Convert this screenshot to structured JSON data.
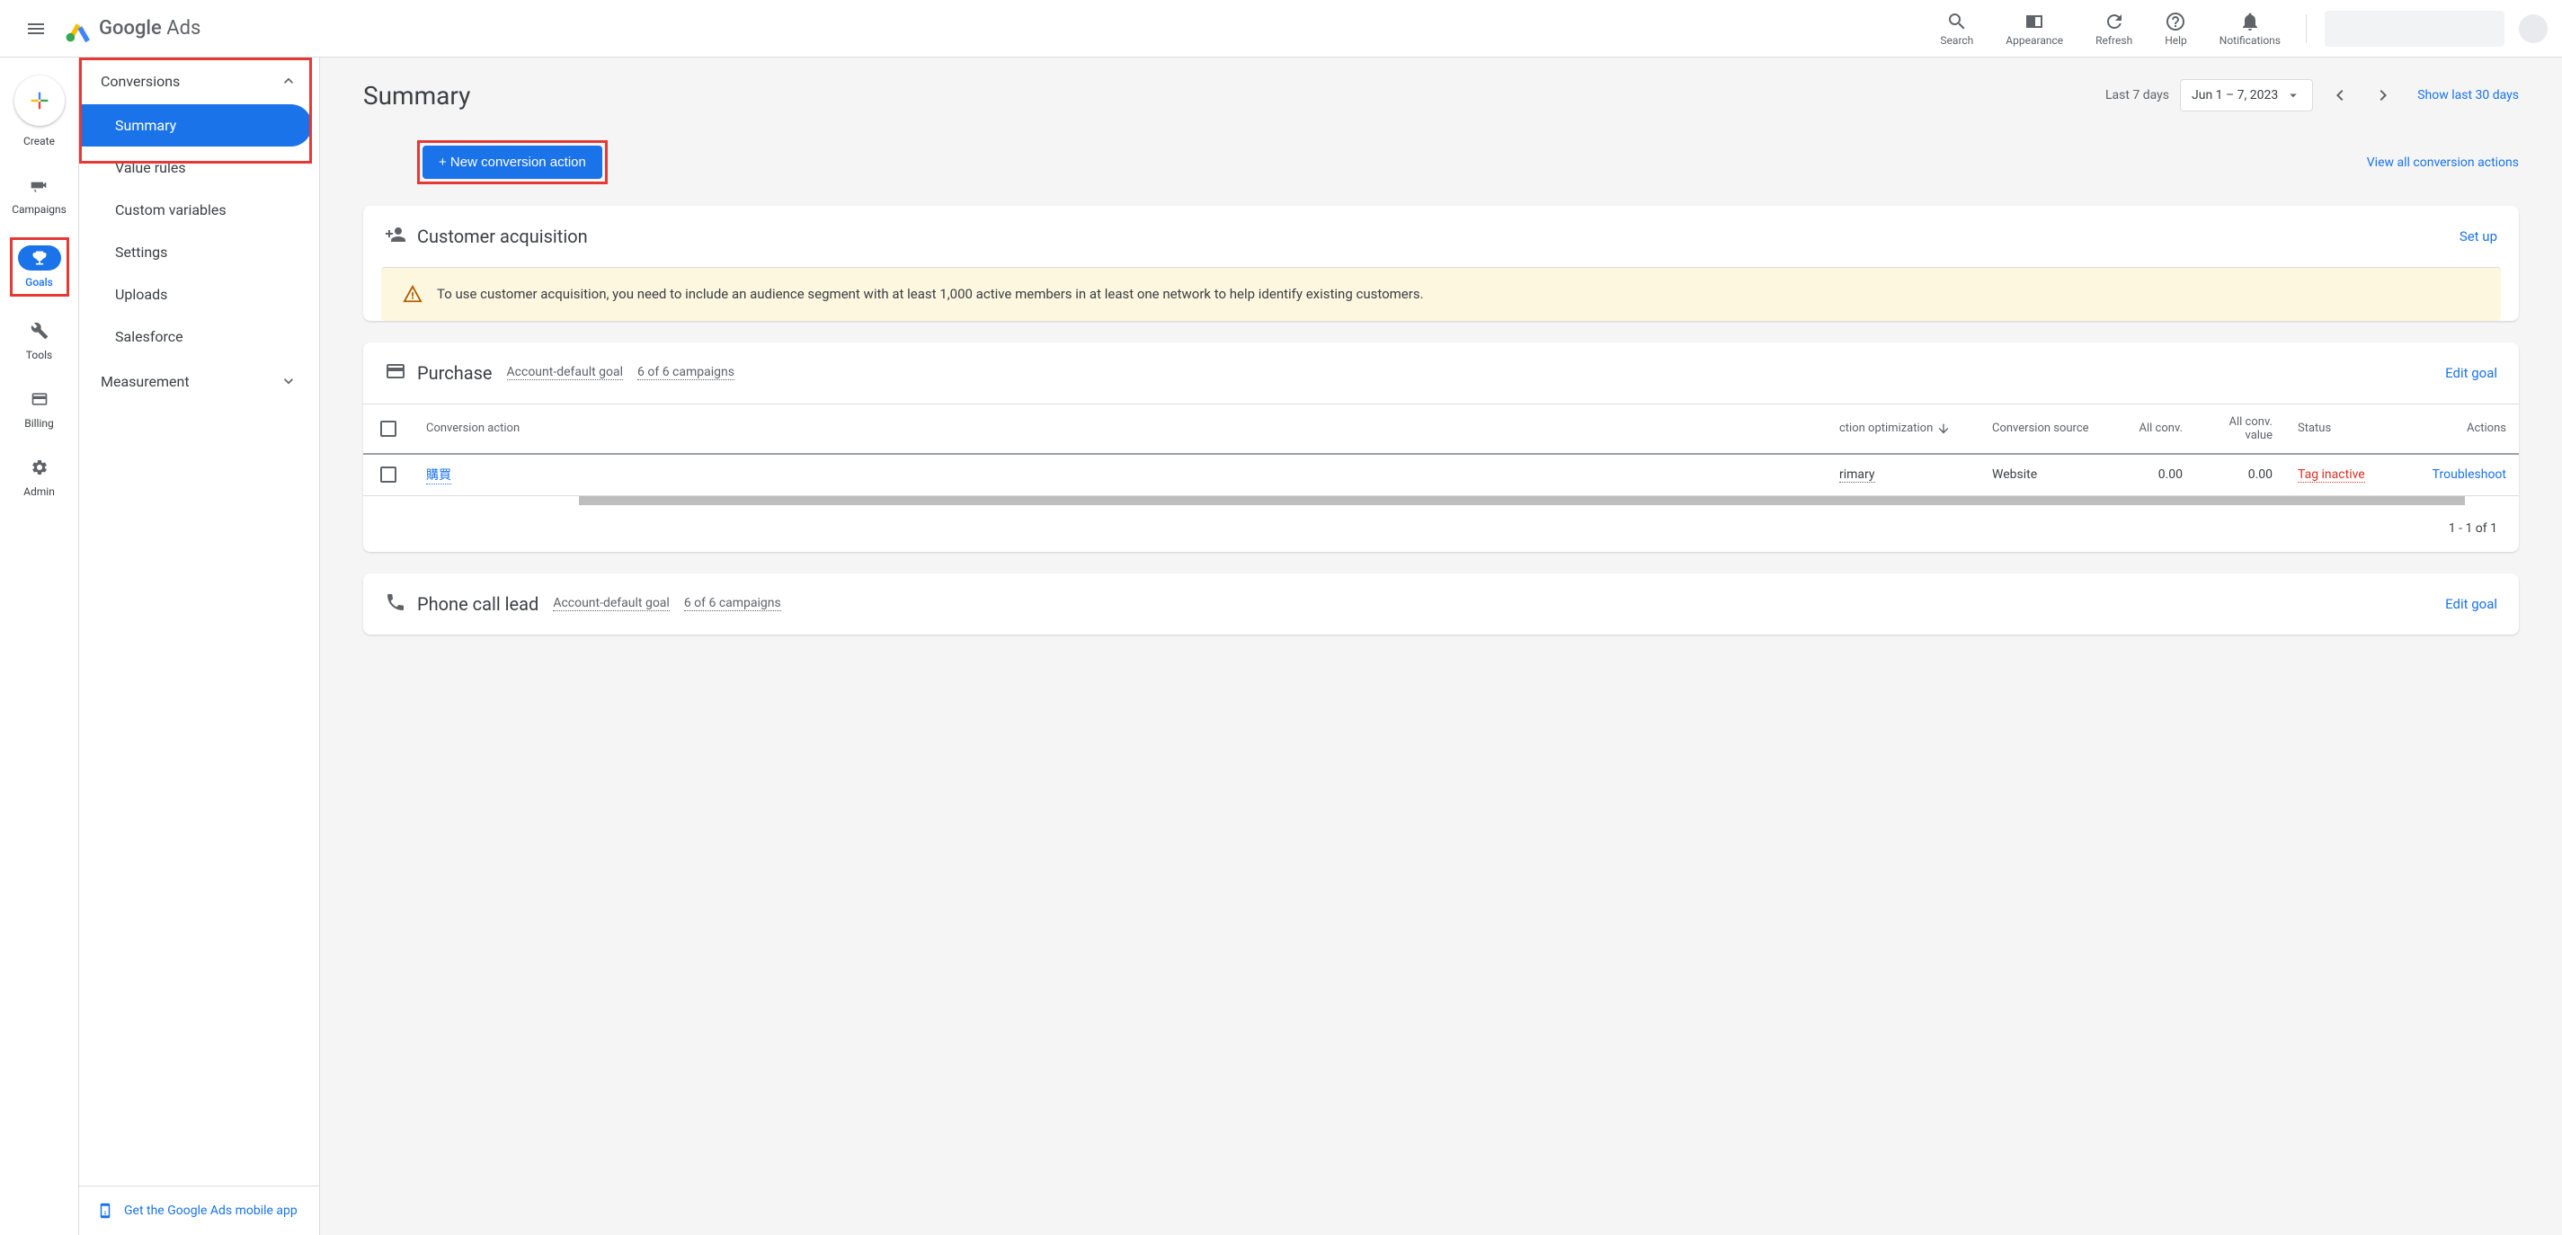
{
  "header": {
    "logo_text_bold": "Google",
    "logo_text_reg": " Ads",
    "actions": {
      "search": "Search",
      "appearance": "Appearance",
      "refresh": "Refresh",
      "help": "Help",
      "notifications": "Notifications"
    }
  },
  "rail": {
    "create": "Create",
    "campaigns": "Campaigns",
    "goals": "Goals",
    "tools": "Tools",
    "billing": "Billing",
    "admin": "Admin"
  },
  "sidebar": {
    "conversions": "Conversions",
    "items": {
      "summary": "Summary",
      "value_rules": "Value rules",
      "custom_vars": "Custom variables",
      "settings": "Settings",
      "uploads": "Uploads",
      "salesforce": "Salesforce"
    },
    "measurement": "Measurement",
    "mobile_app": "Get the Google Ads mobile app"
  },
  "page": {
    "title": "Summary",
    "date_label": "Last 7 days",
    "date_range": "Jun 1 – 7, 2023",
    "show_30": "Show last 30 days",
    "new_conv": "+ New conversion action",
    "view_all": "View all conversion actions"
  },
  "customer_acq": {
    "title": "Customer acquisition",
    "setup": "Set up",
    "warning": "To use customer acquisition, you need to include an audience segment with at least 1,000 active members in at least one network to help identify existing customers."
  },
  "purchase": {
    "title": "Purchase",
    "default_goal": "Account-default goal",
    "campaigns": "6 of 6 campaigns",
    "edit": "Edit goal",
    "cols": {
      "action": "Conversion action",
      "opt": "ction optimization",
      "source": "Conversion source",
      "allconv": "All conv.",
      "value": "All conv. value",
      "status": "Status",
      "actions": "Actions"
    },
    "row": {
      "name": "購買",
      "opt": "rimary",
      "source": "Website",
      "allconv": "0.00",
      "value": "0.00",
      "status": "Tag inactive",
      "troubleshoot": "Troubleshoot"
    },
    "footer": "1 - 1 of 1"
  },
  "phone": {
    "title": "Phone call lead",
    "default_goal": "Account-default goal",
    "campaigns": "6 of 6 campaigns",
    "edit": "Edit goal"
  }
}
